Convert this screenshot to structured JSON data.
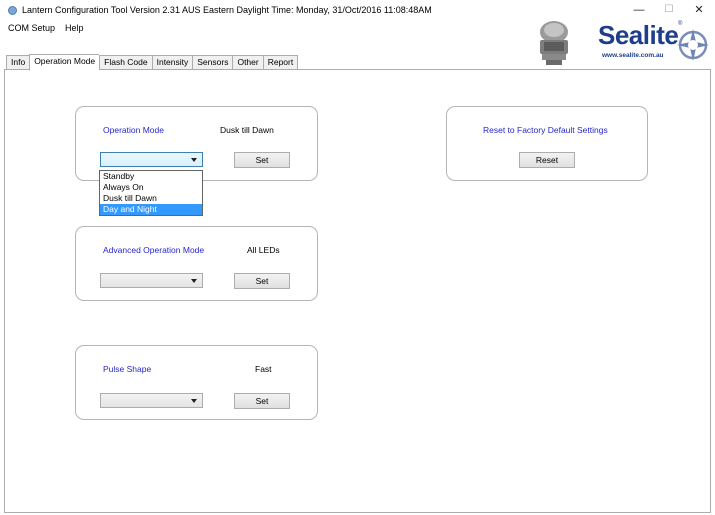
{
  "window": {
    "title": "Lantern Configuration Tool Version 2.31      AUS Eastern Daylight Time: Monday, 31/Oct/2016 11:08:48AM",
    "minimize": "—",
    "maximize": "☐",
    "close": "✕"
  },
  "menu": {
    "items": [
      "COM Setup",
      "Help"
    ]
  },
  "logo": {
    "text": "Sealite",
    "registered": "®",
    "url": "www.sealite.com.au"
  },
  "tabs": [
    "Info",
    "Operation Mode",
    "Flash Code",
    "Intensity",
    "Sensors",
    "Other",
    "Report"
  ],
  "active_tab": "Operation Mode",
  "operation_mode": {
    "label": "Operation Mode",
    "current_value": "Dusk till Dawn",
    "set_label": "Set",
    "selected_option": "",
    "options": [
      "Standby",
      "Always On",
      "Dusk till Dawn",
      "Day and Night"
    ],
    "highlighted_option": "Day and Night"
  },
  "advanced_mode": {
    "label": "Advanced Operation Mode",
    "current_value": "All LEDs",
    "set_label": "Set",
    "selected_option": ""
  },
  "pulse_shape": {
    "label": "Pulse Shape",
    "current_value": "Fast",
    "set_label": "Set",
    "selected_option": ""
  },
  "reset": {
    "label": "Reset to Factory Default Settings",
    "button_label": "Reset"
  },
  "colors": {
    "group_label": "#2626c8",
    "selection": "#3399ff",
    "brand": "#1e3e8a"
  }
}
